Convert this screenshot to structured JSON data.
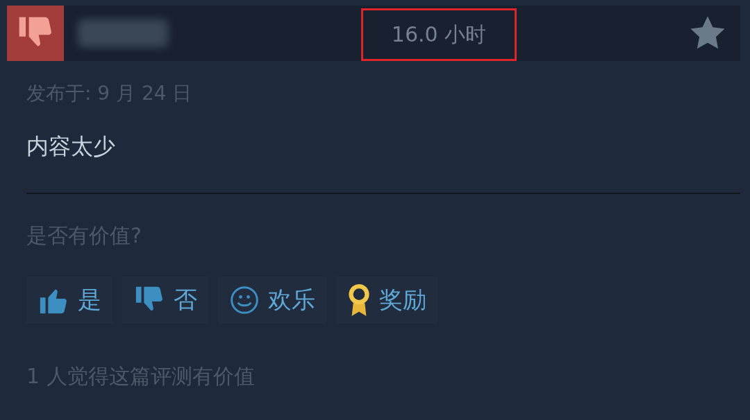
{
  "review": {
    "recommended": false,
    "hours": "16.0 小时",
    "posted": "发布于: 9 月 24 日",
    "text": "内容太少"
  },
  "helpful_prompt": "是否有价值?",
  "buttons": [
    {
      "kind": "thumbs_up",
      "label": "是"
    },
    {
      "kind": "thumbs_down",
      "label": "否"
    },
    {
      "kind": "smile",
      "label": "欢乐"
    },
    {
      "kind": "award",
      "label": "奖励"
    }
  ],
  "helpful_count": "1 人觉得这篇评测有价值"
}
